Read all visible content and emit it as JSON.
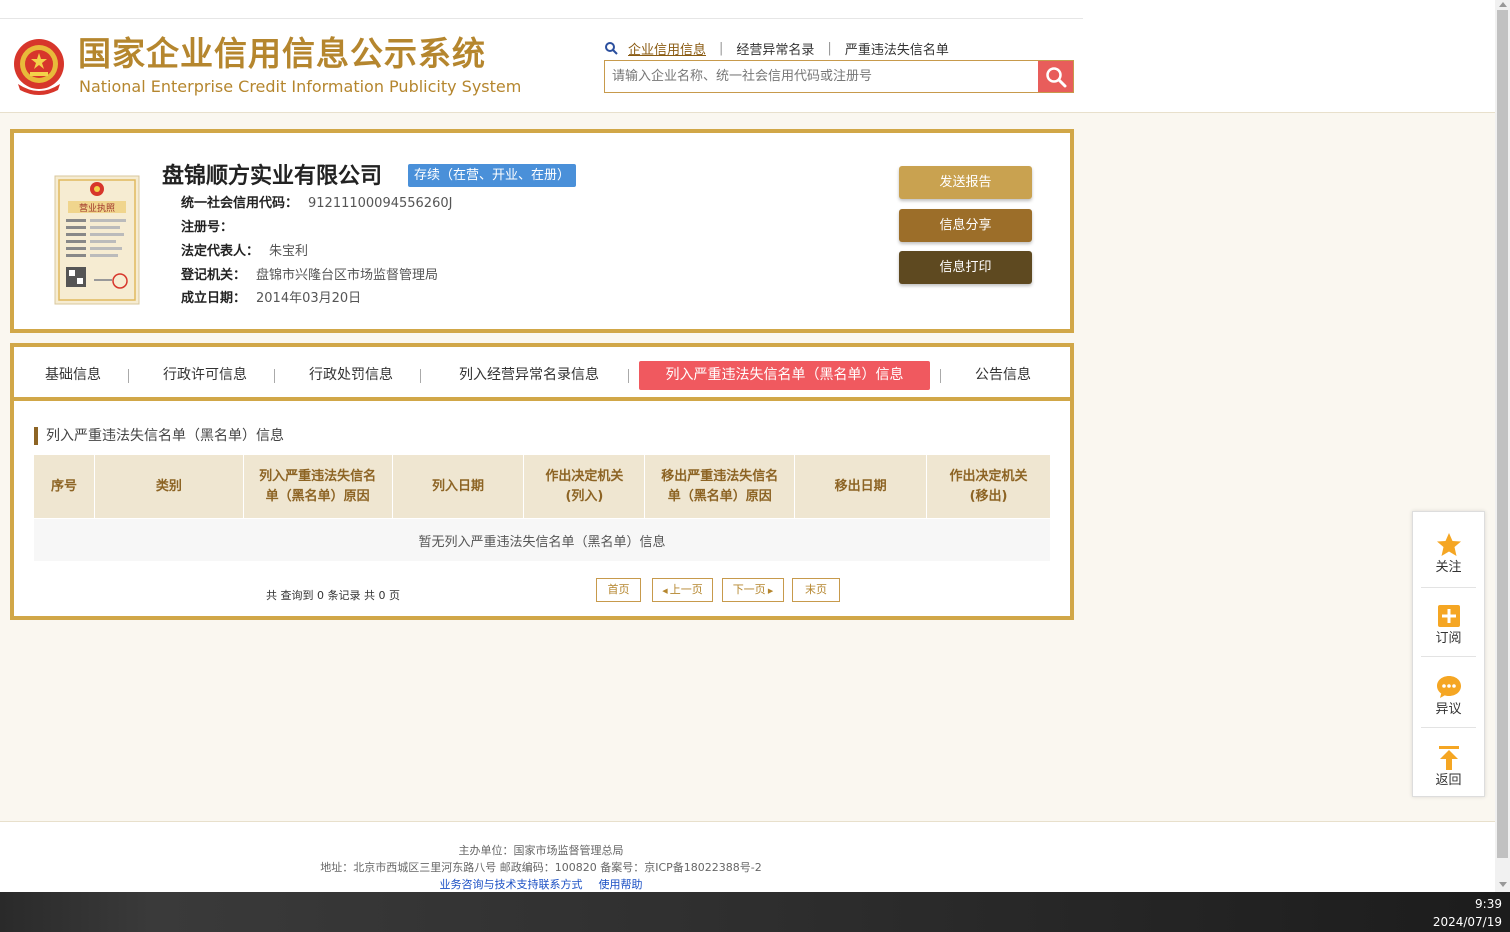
{
  "header": {
    "logo_cn": "国家企业信用信息公示系统",
    "logo_en": "National Enterprise Credit Information Publicity System",
    "links": [
      "企业信用信息",
      "经营异常名录",
      "严重违法失信名单"
    ],
    "search_placeholder": "请输入企业名称、统一社会信用代码或注册号"
  },
  "company": {
    "name": "盘锦顺方实业有限公司",
    "status": "存续（在营、开业、在册）",
    "license_title": "营业执照",
    "fields": [
      {
        "label": "统一社会信用代码：",
        "value": "91211100094556260J"
      },
      {
        "label": "注册号：",
        "value": ""
      },
      {
        "label": "法定代表人：",
        "value": "朱宝利"
      },
      {
        "label": "登记机关：",
        "value": "盘锦市兴隆台区市场监督管理局"
      },
      {
        "label": "成立日期：",
        "value": "2014年03月20日"
      }
    ],
    "buttons": {
      "send": "发送报告",
      "share": "信息分享",
      "print": "信息打印"
    }
  },
  "tabs": [
    "基础信息",
    "行政许可信息",
    "行政处罚信息",
    "列入经营异常名录信息",
    "列入严重违法失信名单（黑名单）信息",
    "公告信息"
  ],
  "active_tab": 4,
  "section_title": "列入严重违法失信名单（黑名单）信息",
  "table": {
    "headers": [
      "序号",
      "类别",
      "列入严重违法失信名单（黑名单）原因",
      "列入日期",
      "作出决定机关(列入)",
      "移出严重违法失信名单（黑名单）原因",
      "移出日期",
      "作出决定机关(移出)"
    ],
    "empty_text": "暂无列入严重违法失信名单（黑名单）信息"
  },
  "pager": {
    "info": "共 查询到 0 条记录 共 0 页",
    "first": "首页",
    "prev": "上一页",
    "next": "下一页",
    "last": "末页"
  },
  "floatbar": [
    "关注",
    "订阅",
    "异议",
    "返回"
  ],
  "footer": {
    "line1": "主办单位：国家市场监督管理总局",
    "line2": "地址：北京市西城区三里河东路八号    邮政编码：100820    备案号：京ICP备18022388号-2",
    "link1": "业务咨询与技术支持联系方式",
    "link2": "使用帮助"
  },
  "taskbar": {
    "time": "9:39",
    "date": "2024/07/19"
  },
  "colors": {
    "gold": "#d1a748",
    "brand": "#b5862e",
    "active_tab": "#f0595f",
    "status": "#4a90d9"
  }
}
